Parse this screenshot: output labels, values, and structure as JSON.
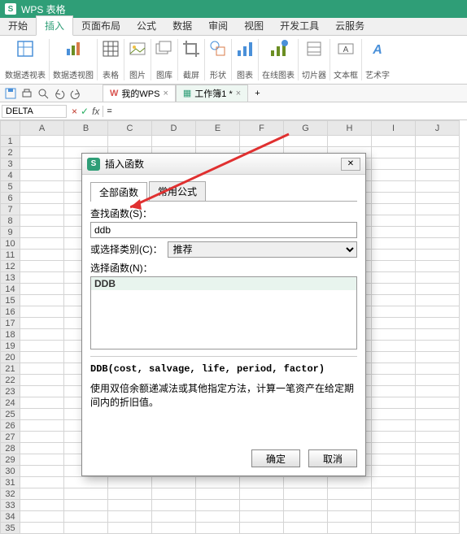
{
  "app": {
    "name": "WPS 表格"
  },
  "menu_tabs": [
    "开始",
    "插入",
    "页面布局",
    "公式",
    "数据",
    "审阅",
    "视图",
    "开发工具",
    "云服务"
  ],
  "active_menu_tab": 1,
  "ribbon": {
    "pivot_table": "数据透视表",
    "pivot_chart": "数据透视图",
    "table": "表格",
    "picture": "图片",
    "gallery": "图库",
    "crop": "截屏",
    "shapes": "形状",
    "chart": "图表",
    "online_chart": "在线图表",
    "slicer": "切片器",
    "textbox": "文本框",
    "wordart": "艺术字"
  },
  "doc_tabs": {
    "my_wps": "我的WPS",
    "workbook": "工作簿1 *"
  },
  "name_box": "DELTA",
  "formula_value": "=",
  "active_cell_value": "=",
  "columns": [
    "A",
    "B",
    "C",
    "D",
    "E",
    "F",
    "G",
    "H",
    "I",
    "J"
  ],
  "row_count": 35,
  "dialog": {
    "title": "插入函数",
    "tabs": {
      "all": "全部函数",
      "common": "常用公式"
    },
    "search_label": "查找函数(S)：",
    "search_value": "ddb",
    "category_label": "或选择类别(C)：",
    "category_value": "推荐",
    "select_label": "选择函数(N)：",
    "list": [
      "DDB"
    ],
    "signature": "DDB(cost, salvage, life, period, factor)",
    "description": "使用双倍余额递减法或其他指定方法，计算一笔资产在给定期间内的折旧值。",
    "ok": "确定",
    "cancel": "取消"
  }
}
